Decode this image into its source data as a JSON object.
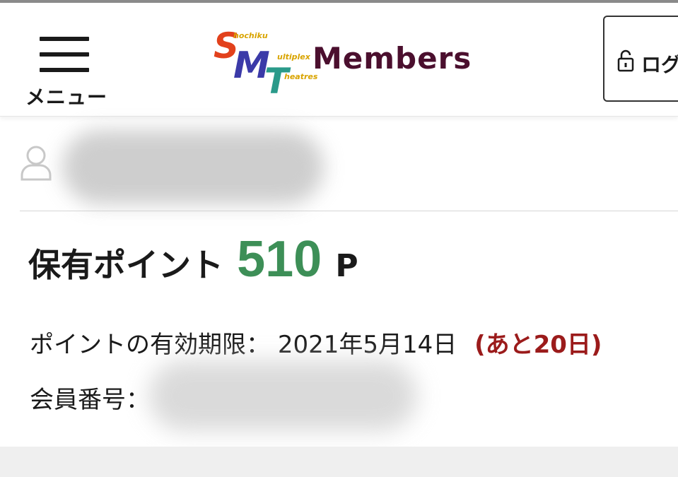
{
  "header": {
    "menu_label": "メニュー",
    "logo": {
      "letters": [
        "S",
        "M",
        "T"
      ],
      "words": [
        "hochiku",
        "ultiplex",
        "heatres"
      ],
      "members": "Members"
    },
    "login_label": "ログ"
  },
  "user": {
    "icon": "user-outline-icon"
  },
  "points": {
    "label": "保有ポイント",
    "value": "510",
    "unit": "P"
  },
  "expiry": {
    "label": "ポイントの有効期限：",
    "date": "2021年5月14日",
    "remaining": "(あと20日)"
  },
  "member": {
    "label": "会員番号："
  },
  "colors": {
    "accent_green": "#3d8f57",
    "remaining_red": "#9b1b1b",
    "logo_s": "#e2411c",
    "logo_m": "#3b3aa8",
    "logo_t": "#2a9a8a",
    "logo_text": "#4b0f2e"
  }
}
